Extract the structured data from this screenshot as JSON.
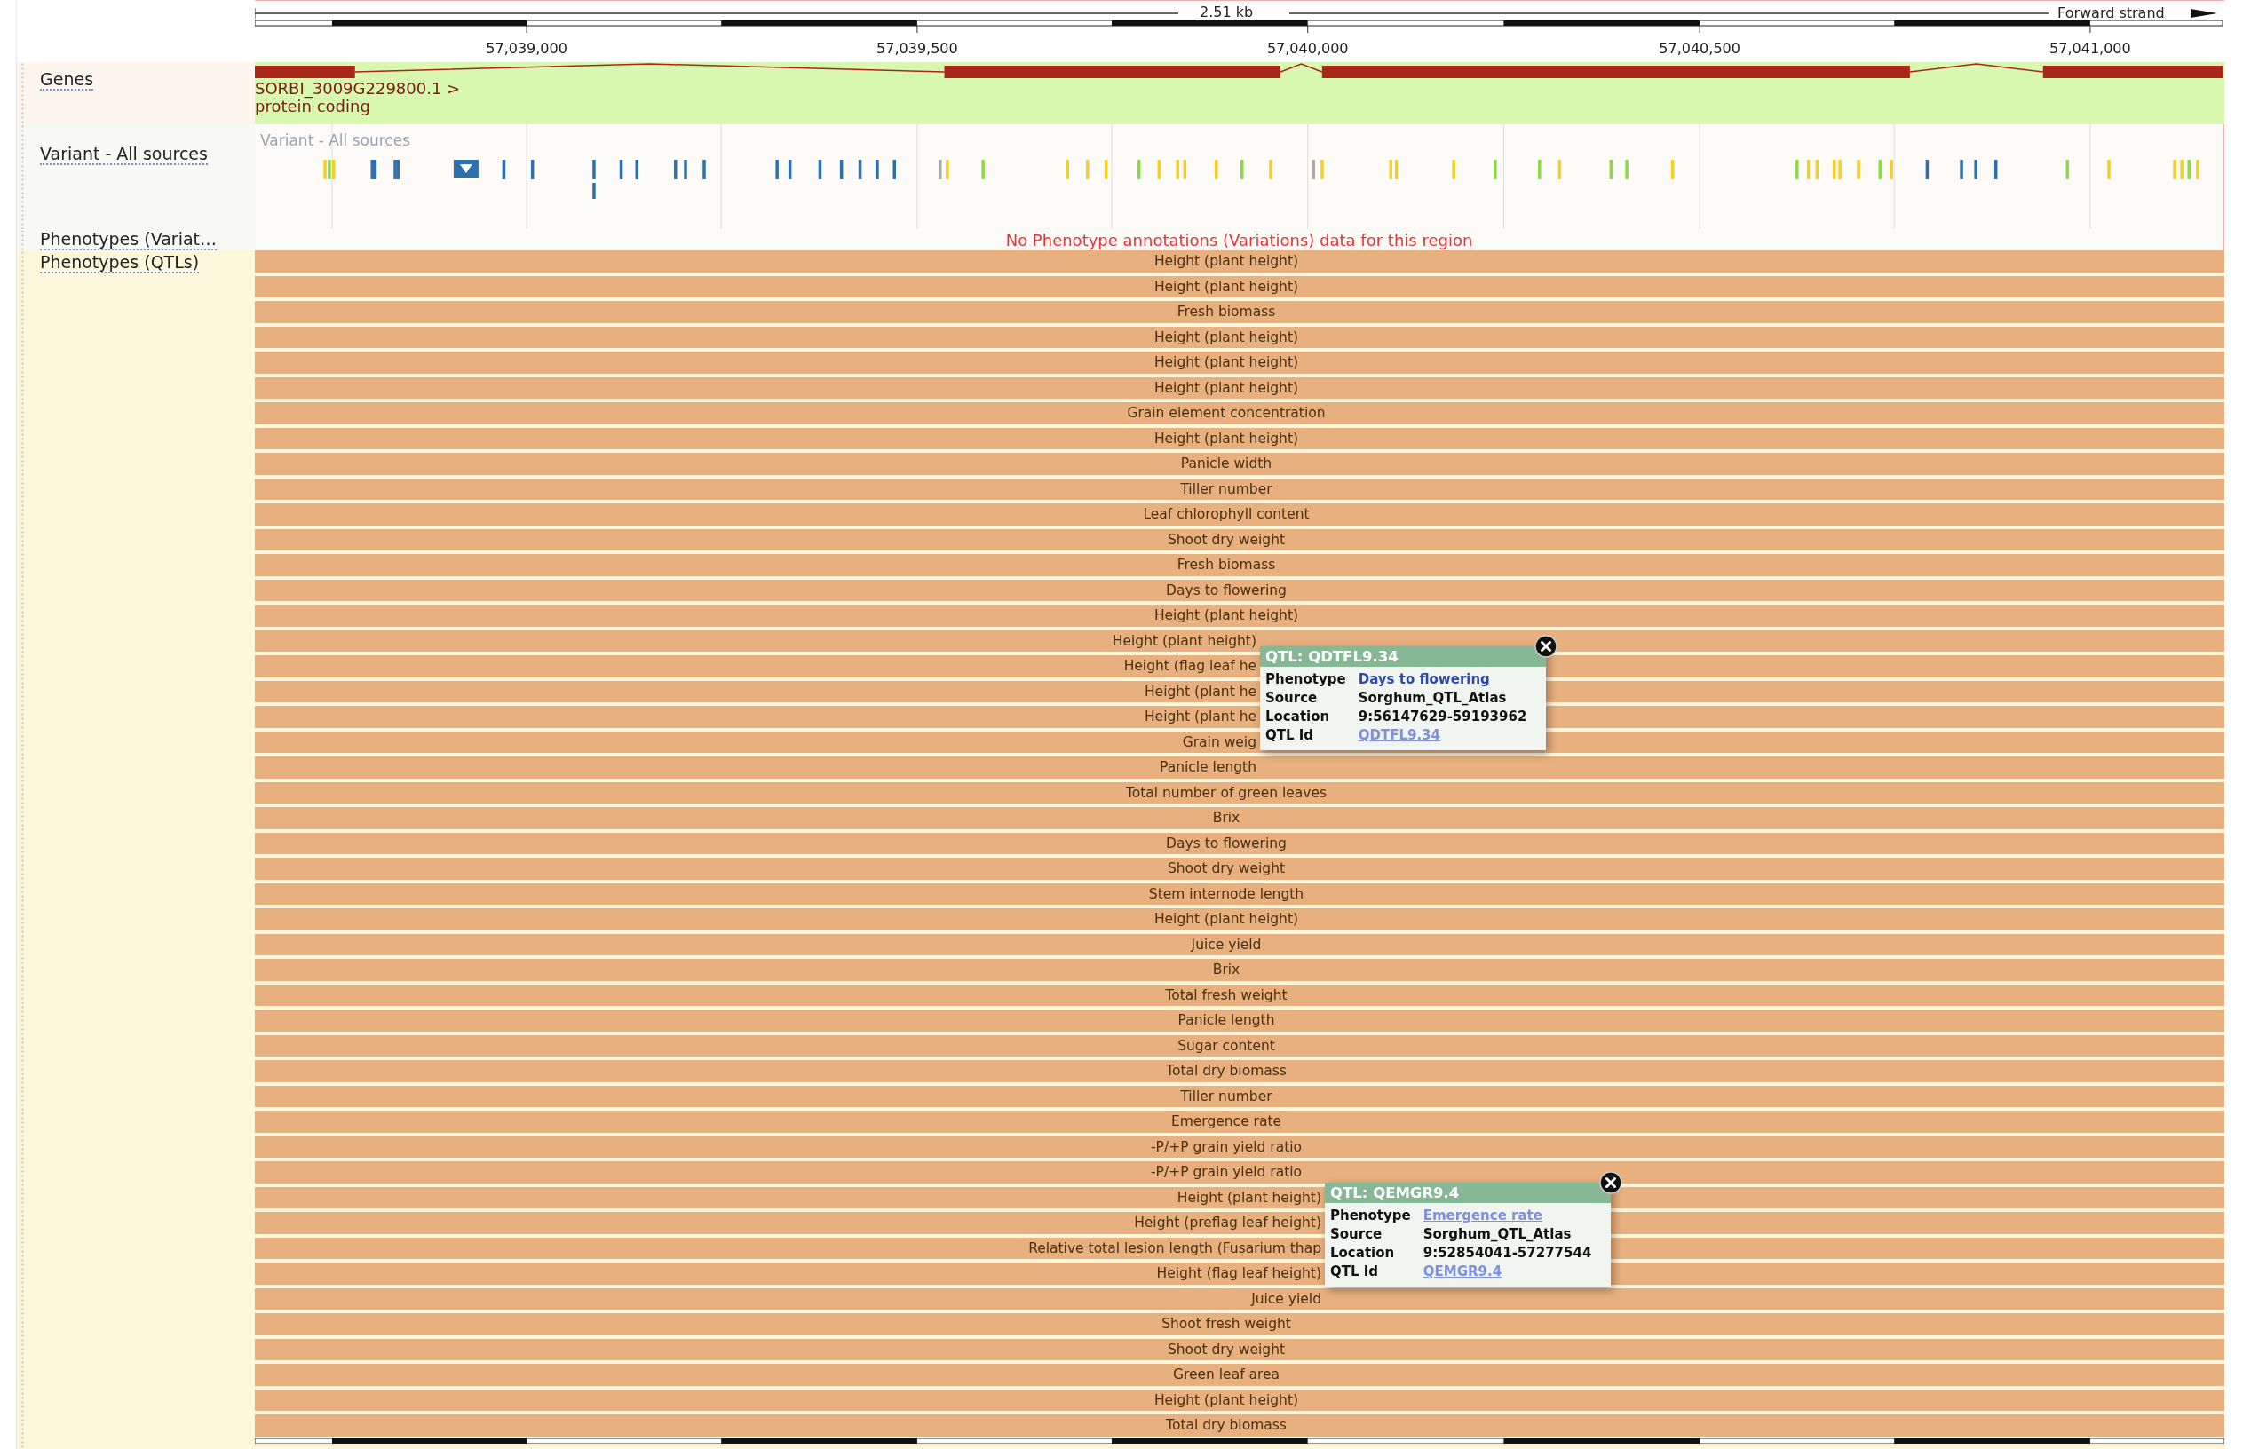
{
  "ruler": {
    "span": "2.51 kb",
    "strand": "Forward strand",
    "ticks": [
      "57,039,000",
      "57,039,500",
      "57,040,000",
      "57,040,500",
      "57,041,000"
    ]
  },
  "tracks": [
    {
      "kind": "genes",
      "label": "Genes",
      "gene_name": "SORBI_3009G229800.1 >",
      "biotype": "protein coding"
    },
    {
      "kind": "variants",
      "label": "Variant - All sources",
      "caption": "Variant - All sources"
    },
    {
      "kind": "message",
      "label": "Phenotypes (Variat…",
      "message": "No Phenotype annotations (Variations) data for this region"
    },
    {
      "kind": "qtls",
      "label": "Phenotypes (QTLs)",
      "rows": [
        {
          "text": "Height (plant height)"
        },
        {
          "text": "Height (plant height)"
        },
        {
          "text": "Fresh biomass"
        },
        {
          "text": "Height (plant height)"
        },
        {
          "text": "Height (plant height)"
        },
        {
          "text": "Height (plant height)"
        },
        {
          "text": "Grain element concentration"
        },
        {
          "text": "Height (plant height)"
        },
        {
          "text": "Panicle width"
        },
        {
          "text": "Tiller number"
        },
        {
          "text": "Leaf chlorophyll content"
        },
        {
          "text": "Shoot dry weight"
        },
        {
          "text": "Fresh biomass"
        },
        {
          "text": "Days to flowering"
        },
        {
          "text": "Height (plant height)"
        },
        {
          "text": "Height (plant height)"
        },
        {
          "text": "Height (flag leaf he"
        },
        {
          "text": "Height (plant he"
        },
        {
          "text": "Height (plant he"
        },
        {
          "text": "Grain weig"
        },
        {
          "text": "Panicle length"
        },
        {
          "text": "Total number of green leaves"
        },
        {
          "text": "Brix"
        },
        {
          "text": "Days to flowering"
        },
        {
          "text": "Shoot dry weight"
        },
        {
          "text": "Stem internode length"
        },
        {
          "text": "Height (plant height)"
        },
        {
          "text": "Juice yield"
        },
        {
          "text": "Brix"
        },
        {
          "text": "Total fresh weight"
        },
        {
          "text": "Panicle length"
        },
        {
          "text": "Sugar content"
        },
        {
          "text": "Total dry biomass"
        },
        {
          "text": "Tiller number"
        },
        {
          "text": "Emergence rate"
        },
        {
          "text": "-P/+P grain yield ratio"
        },
        {
          "text": "-P/+P grain yield ratio"
        },
        {
          "text": "Height (plant height)"
        },
        {
          "text": "Height (preflag leaf height)"
        },
        {
          "text": "Relative total lesion length (Fusarium thap"
        },
        {
          "text": "Height (flag leaf height)"
        },
        {
          "text": "Juice yield"
        },
        {
          "text": "Shoot fresh weight"
        },
        {
          "text": "Shoot dry weight"
        },
        {
          "text": "Green leaf area"
        },
        {
          "text": "Height (plant height)"
        },
        {
          "text": "Total dry biomass"
        }
      ]
    }
  ],
  "popups": [
    {
      "title": "QTL: QDTFL9.34",
      "fields": [
        {
          "label": "Phenotype",
          "value": "Days to flowering",
          "kind": "link",
          "visited": true
        },
        {
          "label": "Source",
          "value": "Sorghum_QTL_Atlas",
          "kind": "text"
        },
        {
          "label": "Location",
          "value": "9:56147629-59193962",
          "kind": "text"
        },
        {
          "label": "QTL Id",
          "value": "QDTFL9.34",
          "kind": "link",
          "visited": false
        }
      ]
    },
    {
      "title": "QTL: QEMGR9.4",
      "fields": [
        {
          "label": "Phenotype",
          "value": "Emergence rate",
          "kind": "link",
          "visited": false
        },
        {
          "label": "Source",
          "value": "Sorghum_QTL_Atlas",
          "kind": "text"
        },
        {
          "label": "Location",
          "value": "9:52854041-57277544",
          "kind": "text"
        },
        {
          "label": "QTL Id",
          "value": "QEMGR9.4",
          "kind": "link",
          "visited": false
        }
      ]
    }
  ]
}
